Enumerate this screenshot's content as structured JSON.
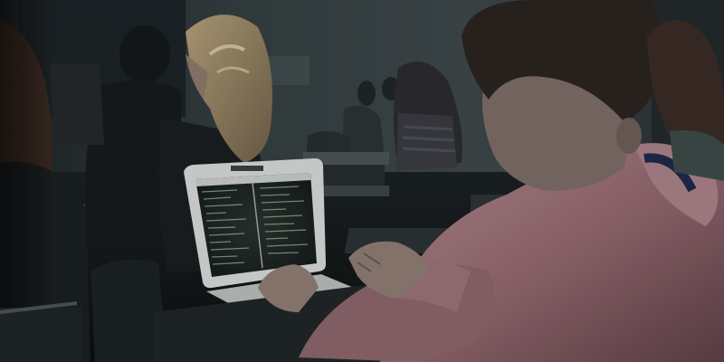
{
  "scene": {
    "colors": {
      "wall": "#3a4446",
      "shadow": "#101315",
      "hoodie": "#a07a7f",
      "hoodie_dark": "#5d4046",
      "screen_bg": "#1d2423",
      "screen_text": "#8fb08a",
      "laptop_frame": "#d5d8d6",
      "skin": "#8f7c74"
    }
  }
}
